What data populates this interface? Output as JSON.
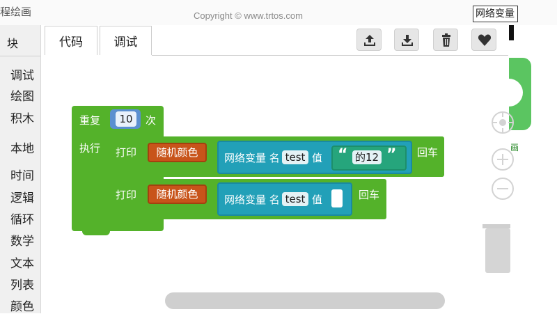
{
  "header": {
    "app_title": "程绘画",
    "copyright": "Copyright © www.trtos.com",
    "search_value": "网络变量"
  },
  "sidebar": {
    "header": "块",
    "categories": [
      "调试",
      "绘图",
      "积木",
      "本地",
      "时间",
      "逻辑",
      "循环",
      "数学",
      "文本",
      "列表",
      "颜色"
    ]
  },
  "tabs": [
    {
      "label": "代码",
      "active": true
    },
    {
      "label": "调试",
      "active": false
    }
  ],
  "toolbar": {
    "buttons": [
      {
        "name": "upload",
        "icon": "upload-icon"
      },
      {
        "name": "download",
        "icon": "download-icon"
      },
      {
        "name": "delete",
        "icon": "trash-icon"
      },
      {
        "name": "favorite",
        "icon": "heart-icon"
      }
    ]
  },
  "blocks": {
    "repeat": {
      "label": "重复",
      "count": "10",
      "times": "次",
      "do": "执行"
    },
    "print1": {
      "label": "打印",
      "color": "随机颜色",
      "var_prefix": "网络变量 名",
      "var_name": "test",
      "value_label": "值",
      "string_value": "的12",
      "newline": "回车"
    },
    "print2": {
      "label": "打印",
      "color": "随机颜色",
      "var_prefix": "网络变量 名",
      "var_name": "test",
      "value_label": "值",
      "newline": "回车"
    },
    "quote_open": "“",
    "quote_close": "”"
  },
  "right_panel": {
    "tab_text": "画"
  },
  "colors": {
    "loop_green": "#54b22a",
    "color_orange": "#c8541a",
    "net_teal": "#22a0b8",
    "string_green": "#26a57c",
    "number_blue": "#5b8fd0"
  }
}
